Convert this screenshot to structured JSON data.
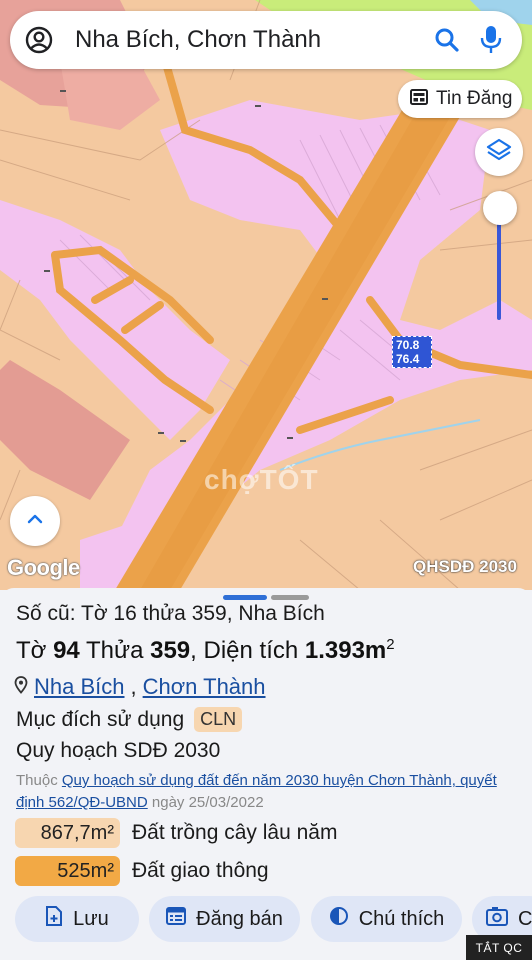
{
  "search": {
    "query": "Nha Bích, Chơn Thành"
  },
  "map": {
    "tin_dang_label": "Tin Đăng",
    "google_logo": "Google",
    "layer_name": "QHSDĐ 2030",
    "parcel_label_top": "70.8",
    "parcel_label_bottom": "76.4",
    "watermark": "chợTỐT"
  },
  "parcel": {
    "old_ref": "Số cũ: Tờ 16 thửa 359, Nha Bích",
    "sheet_label": "Tờ",
    "sheet_no": "94",
    "plot_label": "Thửa",
    "plot_no": "359",
    "area_label": ", Diện tích",
    "area_value": "1.393m",
    "area_unit_sup": "2",
    "commune": "Nha Bích",
    "district": "Chơn Thành",
    "purpose_label": "Mục đích sử dụng",
    "purpose_code": "CLN",
    "plan_label": "Quy hoạch SDĐ 2030",
    "source_prefix": "Thuộc",
    "source_link": "Quy hoạch sử dụng đất đến năm 2030 huyện Chơn Thành, quyết định 562/QĐ-UBND",
    "source_date": "ngày 25/03/2022",
    "areas": [
      {
        "value": "867,7m²",
        "desc": "Đất trồng cây lâu năm",
        "color": "#f7d6b0"
      },
      {
        "value": "525m²",
        "desc": "Đất giao thông",
        "color": "#f2a945"
      }
    ]
  },
  "actions": {
    "save": "Lưu",
    "post": "Đăng bán",
    "legend": "Chú thích",
    "capture_partial": "C"
  },
  "ad_badge": "TẮT QC",
  "colors": {
    "accent": "#2f6fd6",
    "map_base": "#f4c9a0",
    "residential": "#f3c3f0",
    "road": "#eba24a",
    "commercial": "#e99a90"
  },
  "icons": {
    "account": "account-circle-icon",
    "search": "search-icon",
    "mic": "mic-icon",
    "news": "newspaper-icon",
    "layers": "layers-icon",
    "expand": "chevron-up-icon",
    "pin": "location-pin-icon",
    "save": "add-note-icon",
    "post": "listing-icon",
    "legend": "contrast-icon",
    "capture": "camera-icon"
  }
}
